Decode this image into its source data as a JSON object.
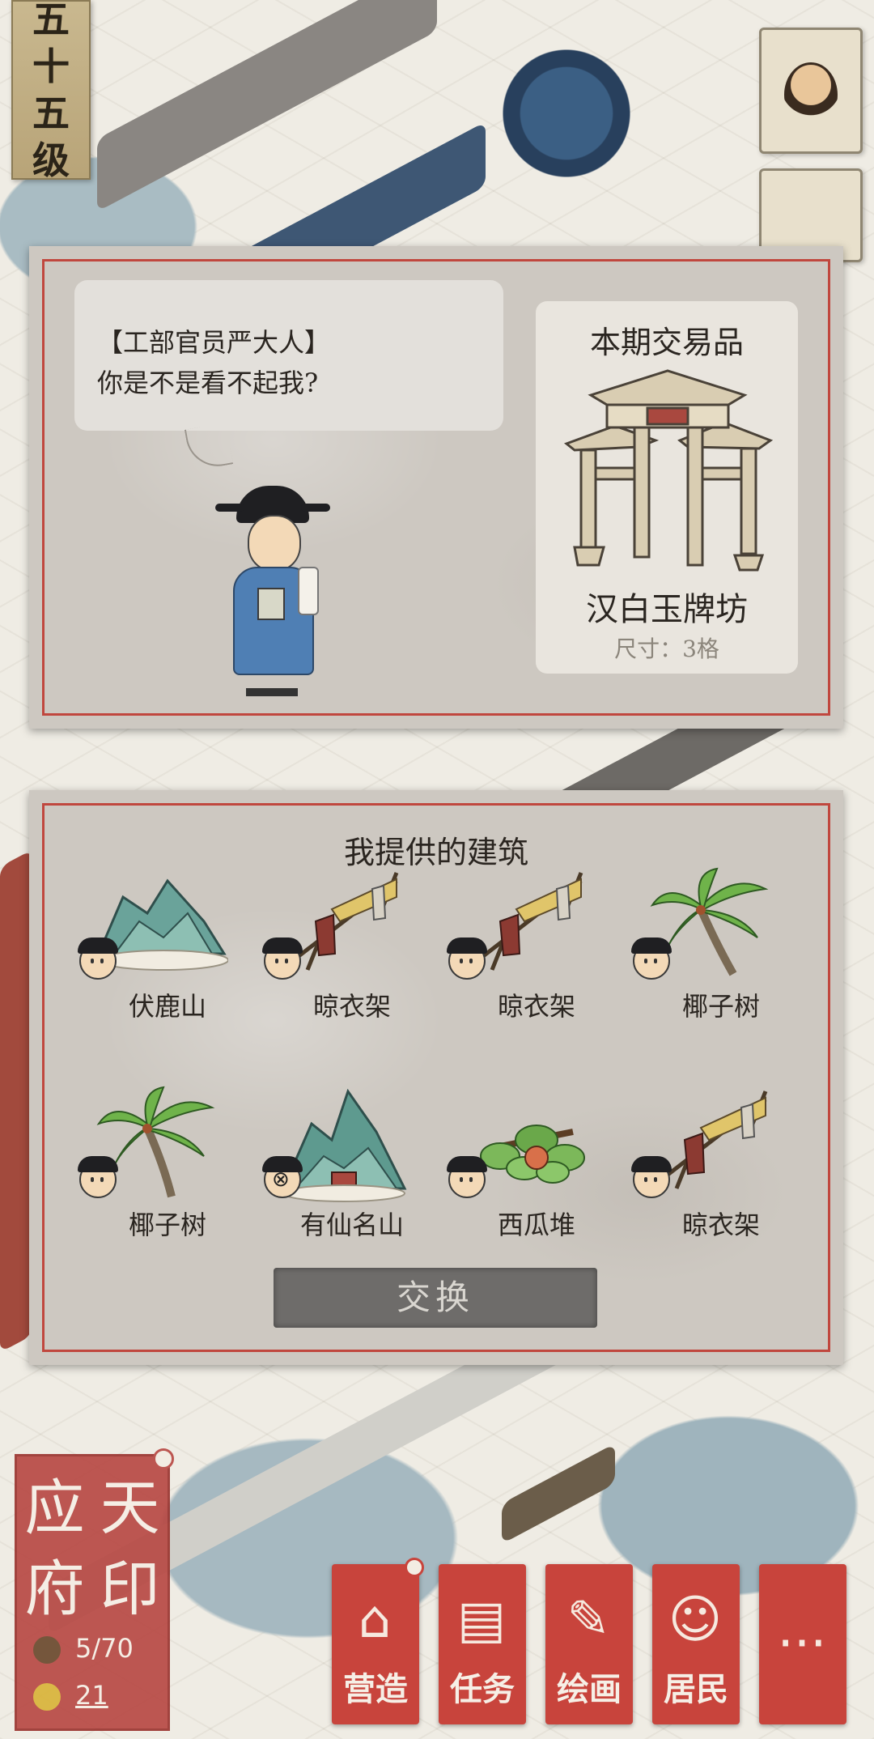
{
  "level": {
    "chars": [
      "五",
      "十",
      "五",
      "级"
    ]
  },
  "merchant": {
    "speaker": "【工部官员严大人】",
    "line": "你是不是看不起我?"
  },
  "trade_item": {
    "heading": "本期交易品",
    "name": "汉白玉牌坊",
    "size": "尺寸：3格"
  },
  "offer": {
    "heading": "我提供的建筑",
    "items": [
      {
        "label": "伏鹿山",
        "icon": "mountain-icon"
      },
      {
        "label": "晾衣架",
        "icon": "clothes-rack-icon"
      },
      {
        "label": "晾衣架",
        "icon": "clothes-rack-icon"
      },
      {
        "label": "椰子树",
        "icon": "coconut-tree-icon"
      },
      {
        "label": "椰子树",
        "icon": "coconut-tree-icon"
      },
      {
        "label": "有仙名山",
        "icon": "mountain-icon"
      },
      {
        "label": "西瓜堆",
        "icon": "watermelon-pile-icon"
      },
      {
        "label": "晾衣架",
        "icon": "clothes-rack-icon"
      }
    ],
    "exchange_label": "交换"
  },
  "city": {
    "seal_chars": [
      "应",
      "天",
      "府",
      "印"
    ],
    "population": "5/70",
    "coins": "21"
  },
  "nav": [
    {
      "label": "营造",
      "icon": "construction-icon"
    },
    {
      "label": "任务",
      "icon": "task-book-icon"
    },
    {
      "label": "绘画",
      "icon": "painting-scroll-icon"
    },
    {
      "label": "居民",
      "icon": "resident-icon"
    },
    {
      "label": "···",
      "icon": "more-icon"
    }
  ],
  "colors": {
    "accent_red": "#c8443c",
    "panel_border": "#c0473e",
    "robe_blue": "#4f7fb4"
  }
}
